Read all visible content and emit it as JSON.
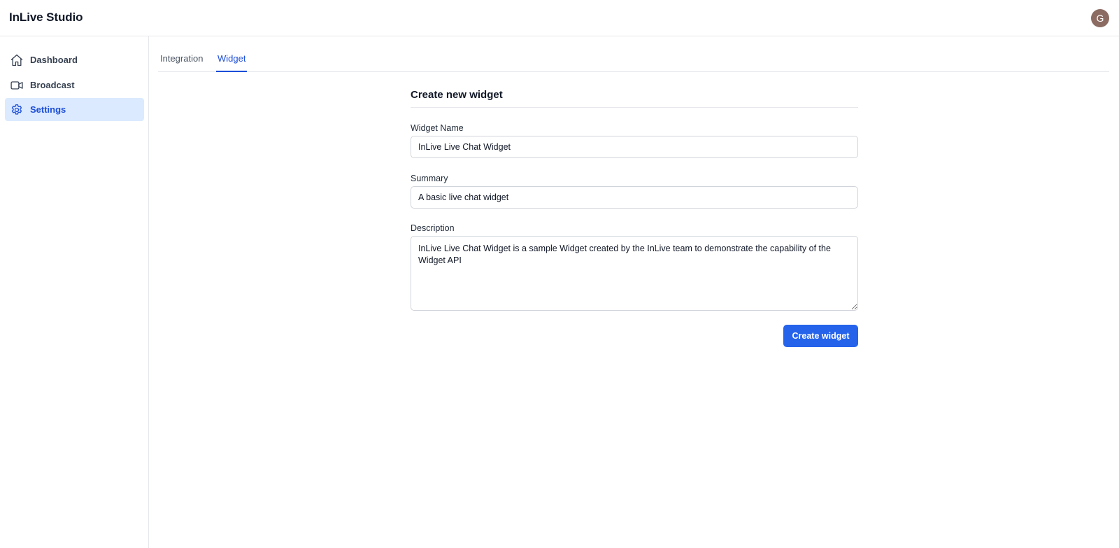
{
  "header": {
    "app_title": "InLive Studio",
    "avatar_initial": "G"
  },
  "sidebar": {
    "items": [
      {
        "label": "Dashboard",
        "icon": "home-icon",
        "active": false
      },
      {
        "label": "Broadcast",
        "icon": "video-camera-icon",
        "active": false
      },
      {
        "label": "Settings",
        "icon": "gear-icon",
        "active": true
      }
    ]
  },
  "tabs": [
    {
      "label": "Integration",
      "active": false
    },
    {
      "label": "Widget",
      "active": true
    }
  ],
  "form": {
    "title": "Create new widget",
    "fields": {
      "name": {
        "label": "Widget Name",
        "value": "InLive Live Chat Widget"
      },
      "summary": {
        "label": "Summary",
        "value": "A basic live chat widget"
      },
      "description": {
        "label": "Description",
        "value": "InLive Live Chat Widget is a sample Widget created by the InLive team to demonstrate the capability of the Widget API"
      }
    },
    "submit_label": "Create widget"
  },
  "colors": {
    "accent": "#2563eb",
    "active_bg": "#dbeafe",
    "avatar_bg": "#8b6b62"
  }
}
